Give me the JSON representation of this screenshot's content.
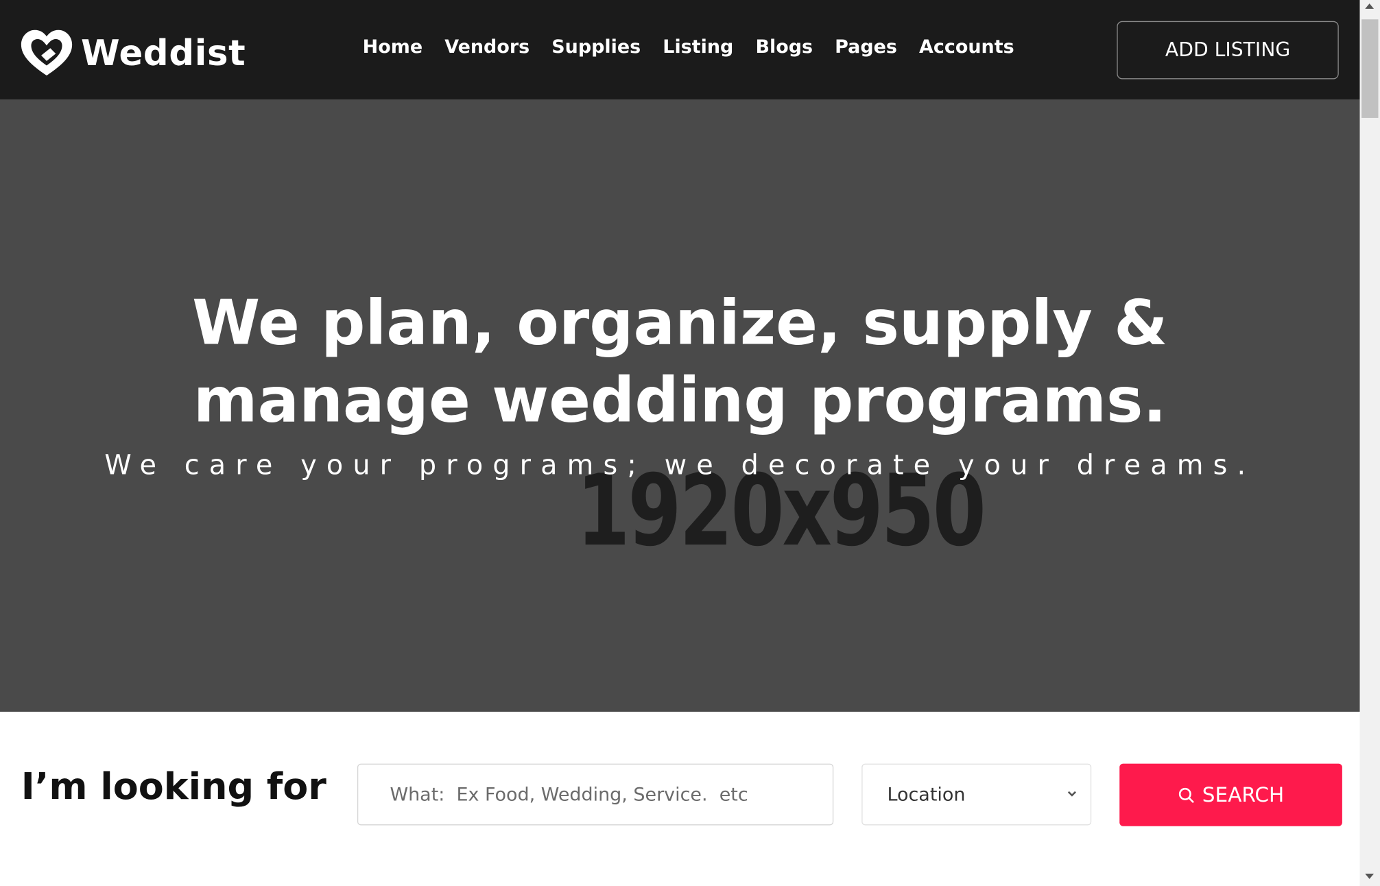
{
  "header": {
    "brand": "Weddist",
    "nav": [
      "Home",
      "Vendors",
      "Supplies",
      "Listing",
      "Blogs",
      "Pages",
      "Accounts"
    ],
    "cta": "ADD LISTING"
  },
  "hero": {
    "title_line1": "We plan, organize, supply &",
    "title_line2": "manage wedding programs.",
    "subtitle": "We care your programs; we decorate your dreams.",
    "placeholder_dims": "1920x950"
  },
  "search": {
    "heading": "I’m looking for",
    "what_placeholder": "What:  Ex Food, Wedding, Service.  etc",
    "location_value": "Location",
    "button_label": "SEARCH"
  },
  "colors": {
    "navbar_bg": "#1b1b1b",
    "hero_bg": "#4a4a4a",
    "accent": "#fe1a4c"
  },
  "icons": {
    "logo": "heart-logo-icon",
    "search": "search-icon",
    "dropdown": "chevron-down-icon"
  }
}
